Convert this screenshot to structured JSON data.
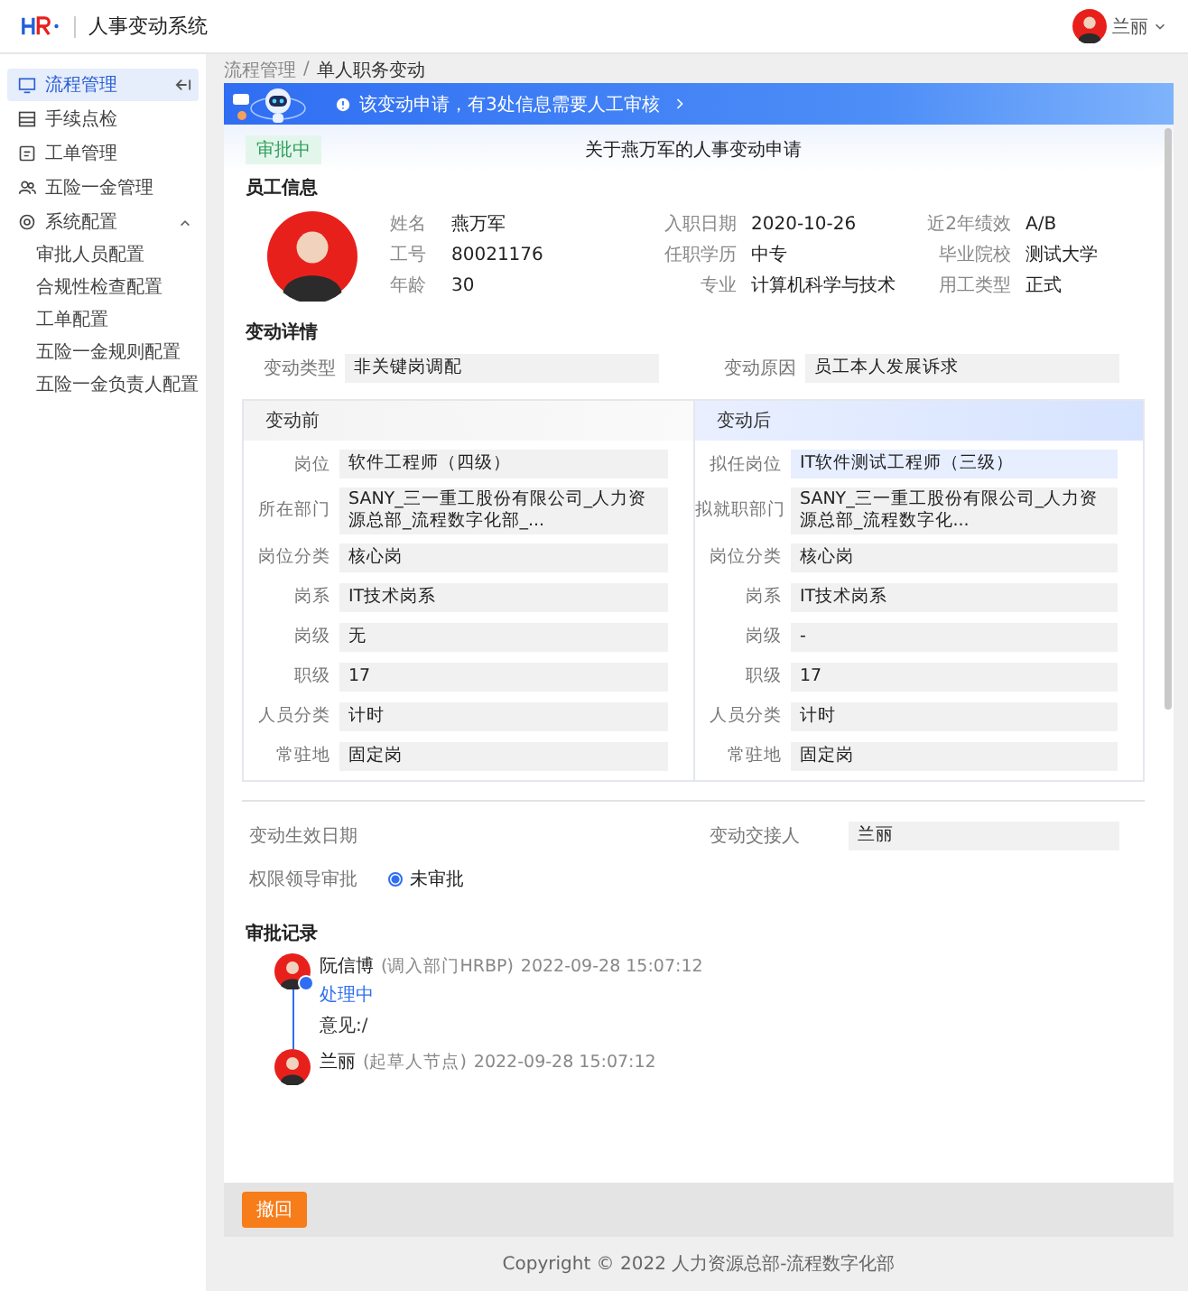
{
  "app": {
    "title": "人事变动系统"
  },
  "user": {
    "name": "兰丽"
  },
  "sidebar": {
    "items": [
      {
        "label": "流程管理",
        "selected": true
      },
      {
        "label": "手续点检",
        "selected": false
      },
      {
        "label": "工单管理",
        "selected": false
      },
      {
        "label": "五险一金管理",
        "selected": false
      },
      {
        "label": "系统配置",
        "selected": false,
        "expanded": true,
        "children": [
          {
            "label": "审批人员配置",
            "selected": false
          },
          {
            "label": "合规性检查配置",
            "selected": false
          },
          {
            "label": "工单配置",
            "selected": false
          },
          {
            "label": "五险一金规则配置",
            "selected": false
          },
          {
            "label": "五险一金负责人配置",
            "selected": false
          }
        ]
      }
    ]
  },
  "breadcrumb": {
    "items": [
      "流程管理",
      "单人职务变动"
    ],
    "separator": "/"
  },
  "banner": {
    "text": "该变动申请，有3处信息需要人工审核"
  },
  "status": {
    "label": "审批中"
  },
  "title": "关于燕万军的人事变动申请",
  "employee_info": {
    "heading": "员工信息",
    "fields": [
      {
        "label": "姓名",
        "value": "燕万军"
      },
      {
        "label": "工号",
        "value": "80021176"
      },
      {
        "label": "年龄",
        "value": "30"
      },
      {
        "label": "入职日期",
        "value": "2020-10-26"
      },
      {
        "label": "任职学历",
        "value": "中专"
      },
      {
        "label": "专业",
        "value": "计算机科学与技术"
      },
      {
        "label": "近2年绩效",
        "value": "A/B"
      },
      {
        "label": "毕业院校",
        "value": "测试大学"
      },
      {
        "label": "用工类型",
        "value": "正式"
      }
    ]
  },
  "change_details": {
    "heading": "变动详情",
    "fields": [
      {
        "label": "变动类型",
        "value": "非关键岗调配"
      },
      {
        "label": "变动原因",
        "value": "员工本人发展诉求"
      }
    ]
  },
  "comparison": [
    {
      "heading": "变动前",
      "selected": false,
      "fields": [
        {
          "label": "岗位",
          "value": "软件工程师（四级）",
          "highlighted": false
        },
        {
          "label": "所在部门",
          "value": "SANY_三一重工股份有限公司_人力资源总部_流程数字化部_...",
          "highlighted": false
        },
        {
          "label": "岗位分类",
          "value": "核心岗",
          "highlighted": false
        },
        {
          "label": "岗系",
          "value": "IT技术岗系",
          "highlighted": false
        },
        {
          "label": "岗级",
          "value": "无",
          "highlighted": false
        },
        {
          "label": "职级",
          "value": "17",
          "highlighted": false
        },
        {
          "label": "人员分类",
          "value": "计时",
          "highlighted": false
        },
        {
          "label": "常驻地",
          "value": "固定岗",
          "highlighted": false
        }
      ]
    },
    {
      "heading": "变动后",
      "selected": true,
      "fields": [
        {
          "label": "拟任岗位",
          "value": "IT软件测试工程师（三级）",
          "highlighted": true
        },
        {
          "label": "拟就职部门",
          "value": "SANY_三一重工股份有限公司_人力资源总部_流程数字化...",
          "highlighted": false
        },
        {
          "label": "岗位分类",
          "value": "核心岗",
          "highlighted": false
        },
        {
          "label": "岗系",
          "value": "IT技术岗系",
          "highlighted": false
        },
        {
          "label": "岗级",
          "value": "-",
          "highlighted": false
        },
        {
          "label": "职级",
          "value": "17",
          "highlighted": false
        },
        {
          "label": "人员分类",
          "value": "计时",
          "highlighted": false
        },
        {
          "label": "常驻地",
          "value": "固定岗",
          "highlighted": false
        }
      ]
    }
  ],
  "handover": [
    {
      "label": "变动生效日期"
    },
    {
      "label": "变动交接人",
      "value": "兰丽"
    }
  ],
  "leader_approval": {
    "label": "权限领导审批",
    "options": [
      {
        "label": "未审批",
        "selected": true
      }
    ]
  },
  "approval_records": {
    "heading": "审批记录",
    "records": [
      {
        "name": "阮信博",
        "role": "(调入部门HRBP)",
        "time": "2022-09-28 15:07:12",
        "status": "处理中",
        "comment": "意见:/"
      },
      {
        "name": "兰丽",
        "role": "(起草人节点)",
        "time": "2022-09-28 15:07:12"
      }
    ]
  },
  "actions": {
    "withdraw": "撤回"
  },
  "footer": "Copyright © 2022 人力资源总部-流程数字化部"
}
